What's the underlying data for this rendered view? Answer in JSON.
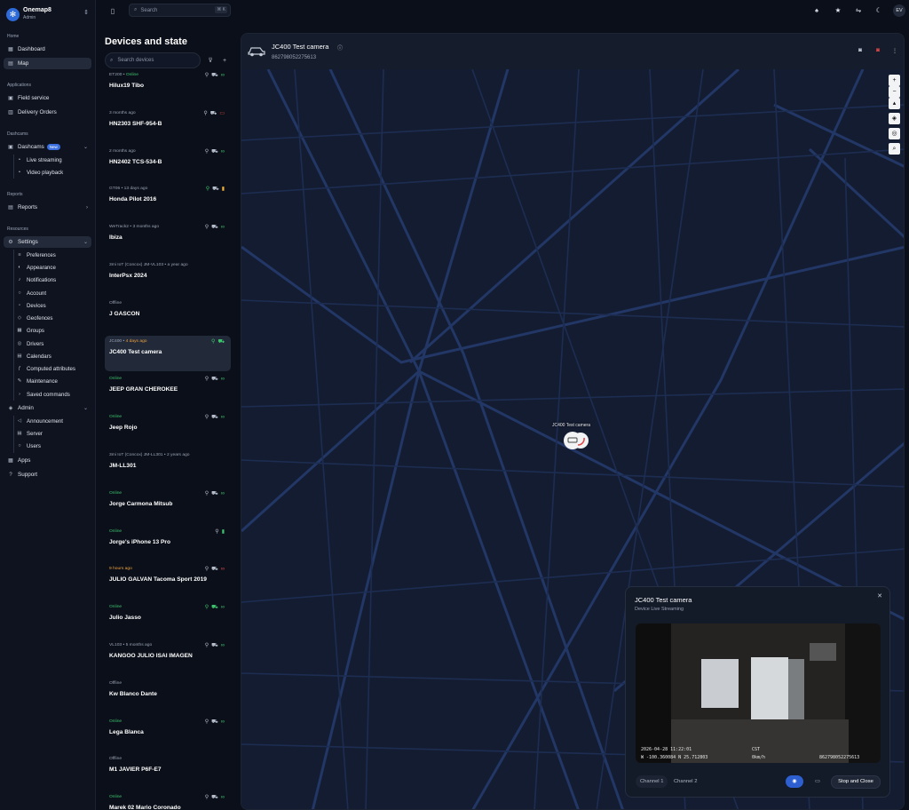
{
  "org": {
    "name": "Onemap8",
    "role": "Admin",
    "logo": "globe-logo"
  },
  "nav": {
    "home": {
      "title": "Home",
      "items": [
        "Dashboard",
        "Map"
      ]
    },
    "applications": {
      "title": "Applications",
      "items": [
        "Field service",
        "Delivery Orders"
      ]
    },
    "dashcams": {
      "title": "Dashcams",
      "label": "Dashcams",
      "badge": "New",
      "items": [
        "Live streaming",
        "Video playback"
      ]
    },
    "reports": {
      "title": "Reports",
      "label": "Reports"
    },
    "resources": {
      "title": "Resources",
      "settings": "Settings",
      "items": [
        "Preferences",
        "Appearance",
        "Notifications",
        "Account",
        "Devices",
        "Geofences",
        "Groups",
        "Drivers",
        "Calendars",
        "Computed attributes",
        "Maintenance",
        "Saved commands"
      ]
    },
    "admin": {
      "label": "Admin",
      "items": [
        "Announcement",
        "Server",
        "Users"
      ]
    },
    "apps": "Apps",
    "support": "Support"
  },
  "topbar": {
    "search_placeholder": "Search",
    "shortcut": "⌘ K",
    "avatar": "EV"
  },
  "device_list": {
    "title": "Devices and state",
    "search_placeholder": "Search devices",
    "devices": [
      {
        "sub": "ET200 • ",
        "status": "Online",
        "status_class": "st-online",
        "name": "Hilux19 Tibo",
        "icons": [
          "person",
          "car",
          "link"
        ]
      },
      {
        "sub": "3 months ago",
        "status": "",
        "name": "HN2303 SHF-954-B",
        "icons": [
          "person",
          "car",
          "battery-red"
        ]
      },
      {
        "sub": "2 months ago",
        "status": "",
        "name": "HN2402 TCS-534-B",
        "icons": [
          "person",
          "car",
          "link"
        ]
      },
      {
        "sub": "GT06 • 13 days ago",
        "status": "",
        "name": "Honda Pilot 2016",
        "icons": [
          "person-green",
          "car",
          "battery-yellow"
        ]
      },
      {
        "sub": "WeTrack2 • 3 months ago",
        "status": "",
        "name": "Ibiza",
        "icons": [
          "person",
          "car",
          "link"
        ]
      },
      {
        "sub": "3mi IoT (Concox) JM-VL103 • a year ago",
        "status": "",
        "name": "InterPsx 2024",
        "icons": []
      },
      {
        "sub": "",
        "status": "Offline",
        "status_class": "",
        "name": "J GASCON",
        "icons": []
      },
      {
        "sub": "JC400 • ",
        "status": "4 days ago",
        "status_class": "st-orange",
        "name": "JC400 Test camera",
        "icons": [
          "person-green",
          "car-green"
        ],
        "selected": true
      },
      {
        "sub": "",
        "status": "Online",
        "status_class": "st-online",
        "name": "JEEP GRAN CHEROKEE",
        "icons": [
          "person",
          "car",
          "link"
        ]
      },
      {
        "sub": "",
        "status": "Online",
        "status_class": "st-online",
        "name": "Jeep Rojo",
        "icons": [
          "person",
          "car",
          "link"
        ]
      },
      {
        "sub": "3mi IoT (Concox) JM-LL301 • 2 years ago",
        "status": "",
        "name": "JM-LL301",
        "icons": []
      },
      {
        "sub": "",
        "status": "Online",
        "status_class": "st-online",
        "name": "Jorge Carmona Mitsub",
        "icons": [
          "person",
          "car",
          "link"
        ]
      },
      {
        "sub": "",
        "status": "Online",
        "status_class": "st-online",
        "name": "Jorge's iPhone 13 Pro",
        "icons": [
          "person",
          "battery-green"
        ]
      },
      {
        "sub": "",
        "status": "9 hours ago",
        "status_class": "st-orange",
        "name": "JULIO GALVAN Tacoma Sport 2019",
        "icons": [
          "person",
          "car",
          "link-red"
        ]
      },
      {
        "sub": "",
        "status": "Online",
        "status_class": "st-online",
        "name": "Julio Jasso",
        "icons": [
          "person-green",
          "car-green",
          "link"
        ]
      },
      {
        "sub": "VL103 • 5 months ago",
        "status": "",
        "name": "KANGOO JULIO ISAI IMAGEN",
        "icons": [
          "person",
          "car",
          "link"
        ]
      },
      {
        "sub": "",
        "status": "Offline",
        "status_class": "",
        "name": "Kw Blanco Dante",
        "icons": []
      },
      {
        "sub": "",
        "status": "Online",
        "status_class": "st-online",
        "name": "Lega Blanca",
        "icons": [
          "person",
          "car",
          "link"
        ]
      },
      {
        "sub": "",
        "status": "Offline",
        "status_class": "",
        "name": "M1 JAVIER P6F-E7",
        "icons": []
      },
      {
        "sub": "",
        "status": "Online",
        "status_class": "st-online",
        "name": "Marek 02 Mario Coronado",
        "icons": [
          "person",
          "car",
          "link"
        ]
      }
    ]
  },
  "device_panel": {
    "title": "JC400 Test camera",
    "imei": "862798052275613",
    "marker_label": "JC400 Test camera"
  },
  "stream": {
    "title": "JC400 Test camera",
    "subtitle": "Device Live Streaming",
    "osd_datetime": "2026-04-28 11:22:01",
    "osd_tz": "CST",
    "osd_coords": "W -100.360084  N 25.712803",
    "osd_speed": "0km/h",
    "osd_imei": "862798052275613",
    "channel1": "Channel 1",
    "channel2": "Channel 2",
    "stop_label": "Stop and Close"
  }
}
